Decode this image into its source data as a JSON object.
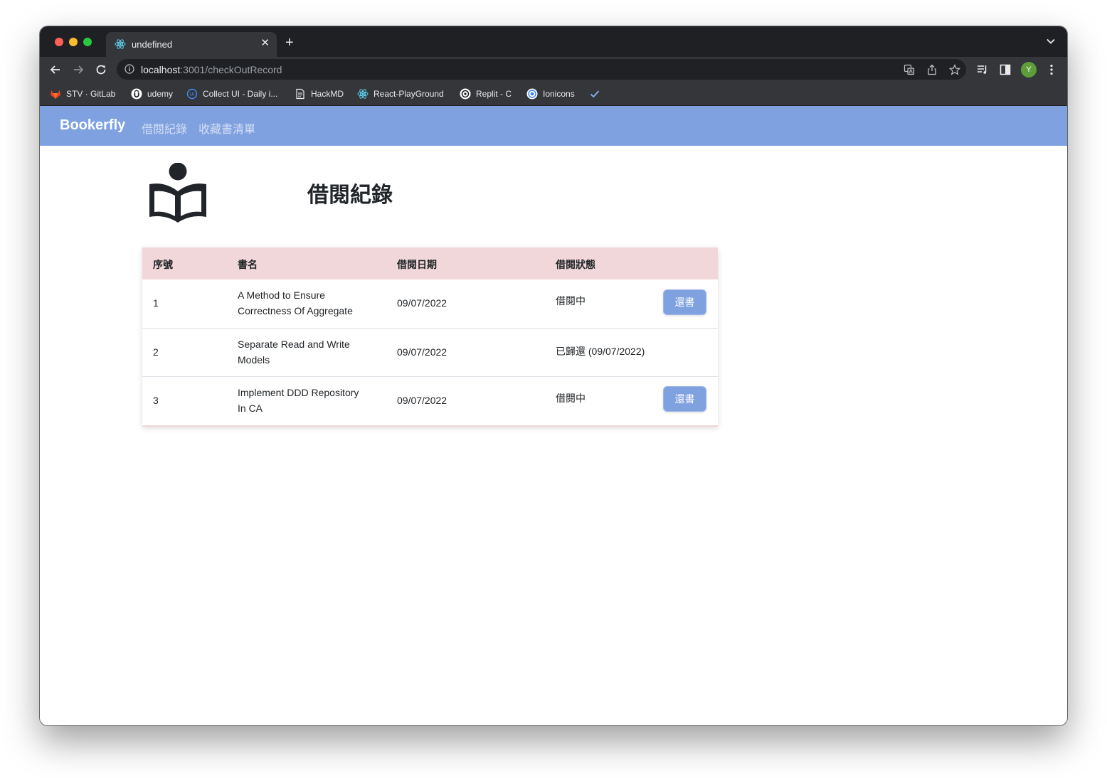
{
  "browser": {
    "tab_title": "undefined",
    "url_host": "localhost",
    "url_path": ":3001/checkOutRecord",
    "avatar_letter": "Y",
    "bookmarks": [
      {
        "label": "STV · GitLab",
        "icon": "gitlab-icon"
      },
      {
        "label": "udemy",
        "icon": "udemy-icon"
      },
      {
        "label": "Collect UI - Daily i...",
        "icon": "collectui-icon"
      },
      {
        "label": "HackMD",
        "icon": "document-icon"
      },
      {
        "label": "React-PlayGround",
        "icon": "react-icon"
      },
      {
        "label": "Replit - C",
        "icon": "replit-icon"
      },
      {
        "label": "Ionicons",
        "icon": "ionicons-icon"
      }
    ]
  },
  "app": {
    "brand": "Bookerfly",
    "nav": [
      "借閱紀錄",
      "收藏書清單"
    ],
    "page_title": "借閱紀錄",
    "colors": {
      "navbar": "#7fa1e0",
      "table_header": "#f1d7d9",
      "button": "#7fa1e0"
    }
  },
  "table": {
    "headers": [
      "序號",
      "書名",
      "借閱日期",
      "借閱狀態"
    ],
    "rows": [
      {
        "index": "1",
        "title_line1": "A Method to Ensure",
        "title_line2": "Correctness Of Aggregate",
        "date": "09/07/2022",
        "status": "借閱中",
        "action": "還書"
      },
      {
        "index": "2",
        "title_line1": "Separate Read and Write",
        "title_line2": "Models",
        "date": "09/07/2022",
        "status": "已歸還 (09/07/2022)",
        "action": ""
      },
      {
        "index": "3",
        "title_line1": "Implement DDD Repository",
        "title_line2": "In CA",
        "date": "09/07/2022",
        "status": "借閱中",
        "action": "還書"
      }
    ]
  }
}
